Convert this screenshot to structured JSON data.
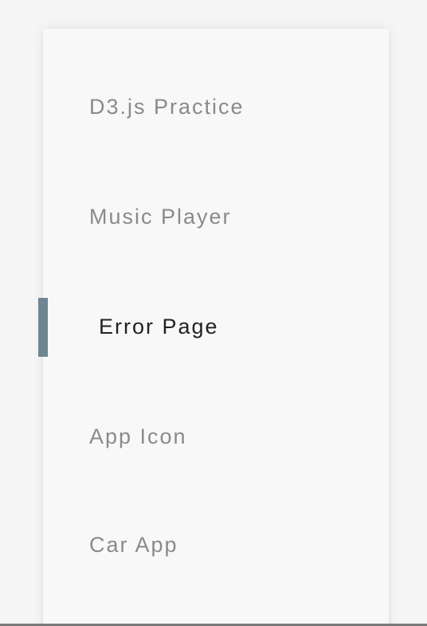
{
  "menu": {
    "items": [
      {
        "label": "D3.js Practice",
        "active": false
      },
      {
        "label": "Music Player",
        "active": false
      },
      {
        "label": "Error Page",
        "active": true
      },
      {
        "label": "App Icon",
        "active": false
      },
      {
        "label": "Car App",
        "active": false
      }
    ]
  },
  "colors": {
    "background": "#f5f5f5",
    "card": "#f8f8f8",
    "inactive_text": "#8a8a8a",
    "active_text": "#222222",
    "active_indicator": "#6f8592"
  }
}
